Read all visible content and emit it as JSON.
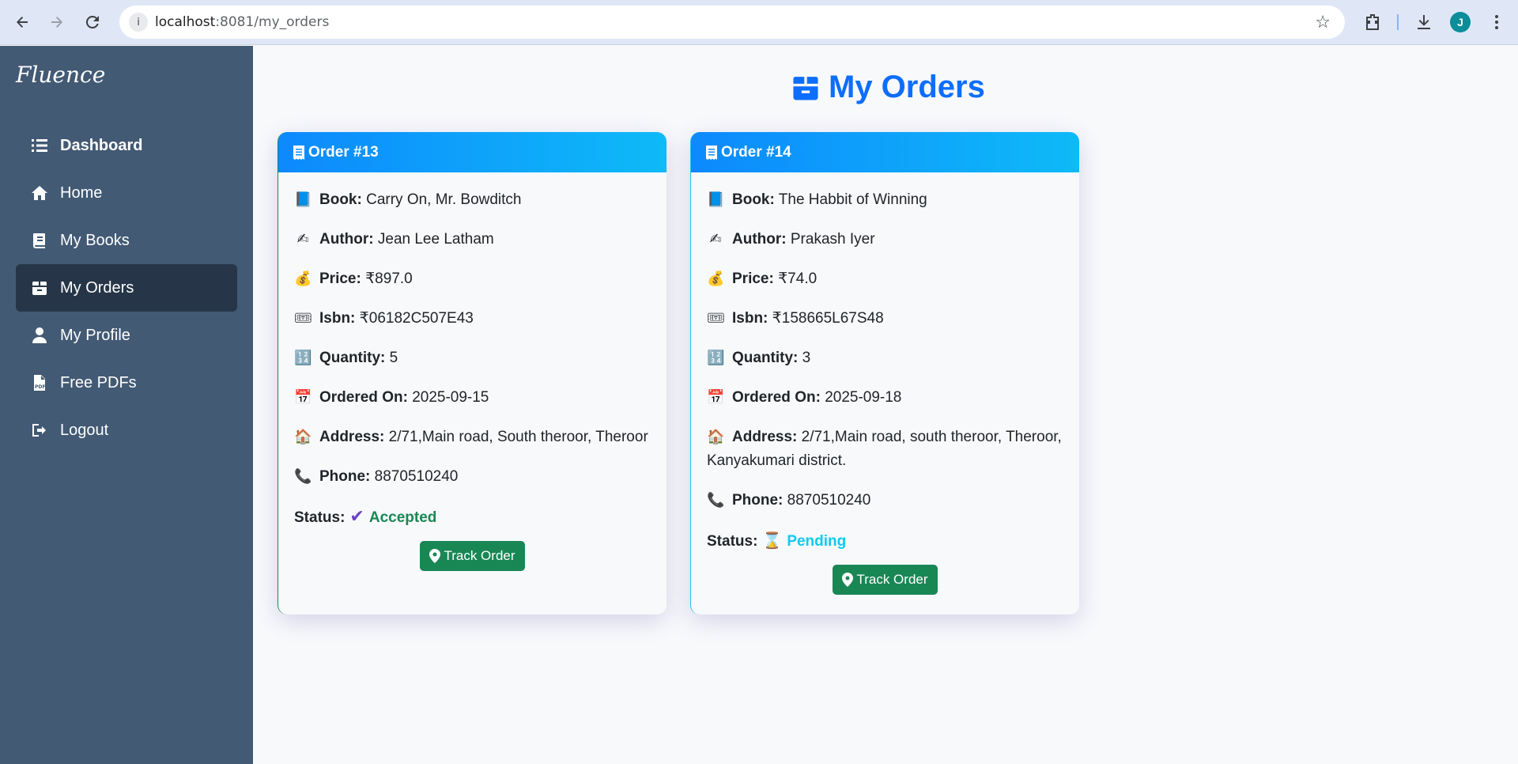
{
  "browser": {
    "url_host": "localhost",
    "url_path": ":8081/my_orders",
    "avatar_letter": "J"
  },
  "sidebar": {
    "brand": "Fluence",
    "items": [
      {
        "label": "Dashboard",
        "icon": "list-icon",
        "bold": true,
        "active": false
      },
      {
        "label": "Home",
        "icon": "home-icon",
        "bold": false,
        "active": false
      },
      {
        "label": "My Books",
        "icon": "book-icon",
        "bold": false,
        "active": false
      },
      {
        "label": "My Orders",
        "icon": "box-icon",
        "bold": false,
        "active": true
      },
      {
        "label": "My Profile",
        "icon": "user-icon",
        "bold": false,
        "active": false
      },
      {
        "label": "Free PDFs",
        "icon": "pdf-icon",
        "bold": false,
        "active": false
      },
      {
        "label": "Logout",
        "icon": "logout-icon",
        "bold": false,
        "active": false
      }
    ]
  },
  "main": {
    "title": "My Orders",
    "labels": {
      "book": "Book:",
      "author": "Author:",
      "price": "Price:",
      "isbn": "Isbn:",
      "quantity": "Quantity:",
      "ordered_on": "Ordered On:",
      "address": "Address:",
      "phone": "Phone:",
      "status": "Status:",
      "track": "Track Order"
    },
    "orders": [
      {
        "header": "Order #13",
        "book": "Carry On, Mr. Bowditch",
        "author": "Jean Lee Latham",
        "price": "₹897.0",
        "isbn": "₹06182C507E43",
        "quantity": "5",
        "ordered_on": "2025-09-15",
        "address": "2/71,Main road, South theroor, Theroor",
        "phone": "8870510240",
        "status": "Accepted"
      },
      {
        "header": "Order #14",
        "book": "The Habbit of Winning",
        "author": "Prakash Iyer",
        "price": "₹74.0",
        "isbn": "₹158665L67S48",
        "quantity": "3",
        "ordered_on": "2025-09-18",
        "address": "2/71,Main road, south theroor, Theroor, Kanyakumari district.",
        "phone": "8870510240",
        "status": "Pending"
      }
    ]
  },
  "colors": {
    "sidebar_bg": "#435a74",
    "sidebar_active": "#263648",
    "primary": "#0d6efd",
    "success": "#198754",
    "info": "#0dcaf0"
  }
}
